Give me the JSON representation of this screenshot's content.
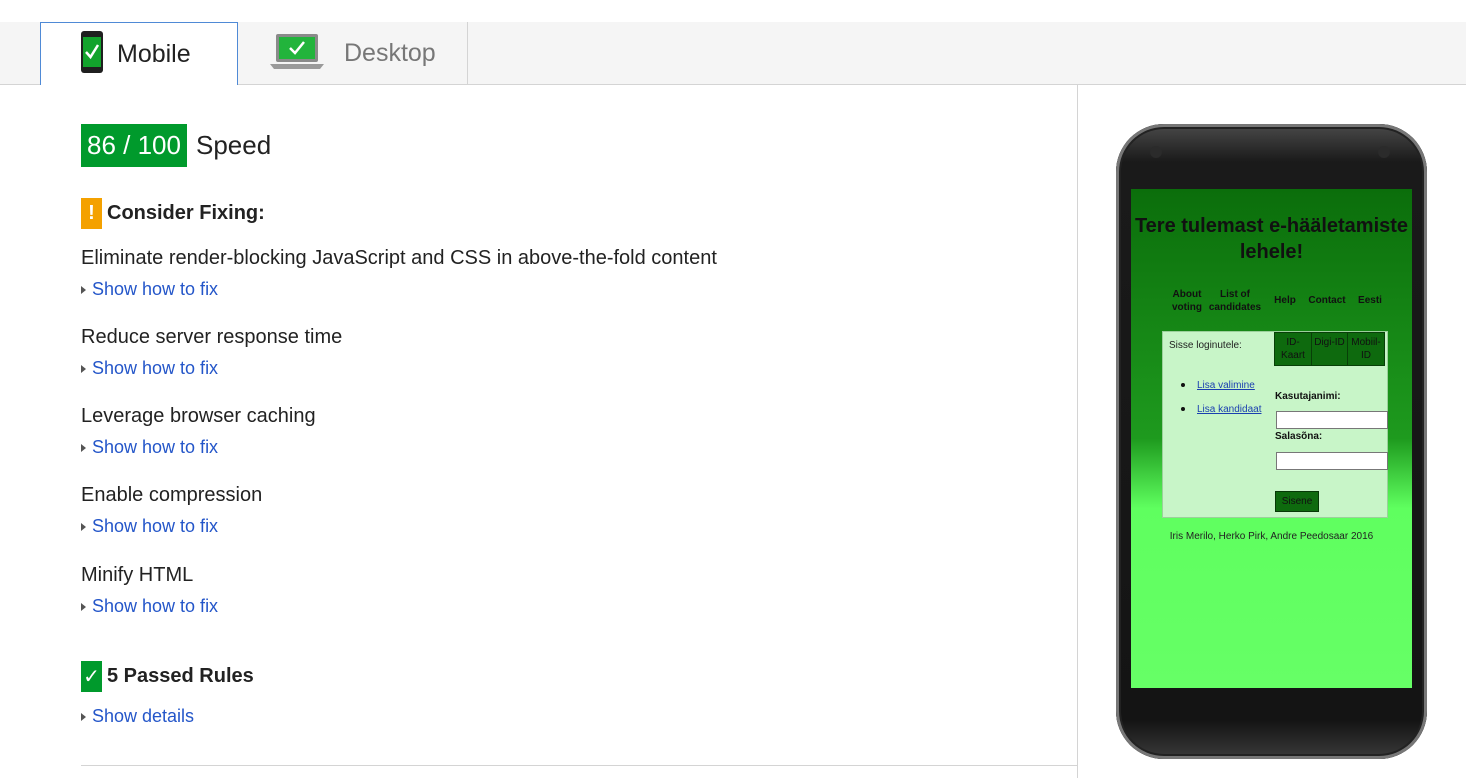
{
  "tabs": [
    {
      "label": "Mobile",
      "icon": "smartphone-check-icon",
      "active": true
    },
    {
      "label": "Desktop",
      "icon": "laptop-check-icon",
      "active": false
    }
  ],
  "score": {
    "value": "86 / 100",
    "label": "Speed",
    "color": "#009a2c"
  },
  "consider": {
    "title": "Consider Fixing:",
    "icon": "warning-icon",
    "icon_glyph": "!",
    "color": "#f4a100",
    "rules": [
      {
        "title": "Eliminate render-blocking JavaScript and CSS in above-the-fold content",
        "link": "Show how to fix"
      },
      {
        "title": "Reduce server response time",
        "link": "Show how to fix"
      },
      {
        "title": "Leverage browser caching",
        "link": "Show how to fix"
      },
      {
        "title": "Enable compression",
        "link": "Show how to fix"
      },
      {
        "title": "Minify HTML",
        "link": "Show how to fix"
      }
    ]
  },
  "passed": {
    "title": "5 Passed Rules",
    "icon": "checkmark-icon",
    "icon_glyph": "✓",
    "link": "Show details"
  },
  "preview": {
    "title": "Tere tulemast e-hääletamiste lehele!",
    "nav": [
      "About voting",
      "List of candidates",
      "Help",
      "Contact",
      "Eesti"
    ],
    "login_label": "Sisse loginutele:",
    "login_tabs": [
      "ID-Kaart",
      "Digi-ID",
      "Mobiil-ID"
    ],
    "links": [
      "Lisa valimine",
      "Lisa kandidaat"
    ],
    "username_label": "Kasutajanimi:",
    "password_label": "Salasõna:",
    "submit": "Sisene",
    "footer": "Iris Merilo, Herko Pirk, Andre Peedosaar 2016"
  }
}
